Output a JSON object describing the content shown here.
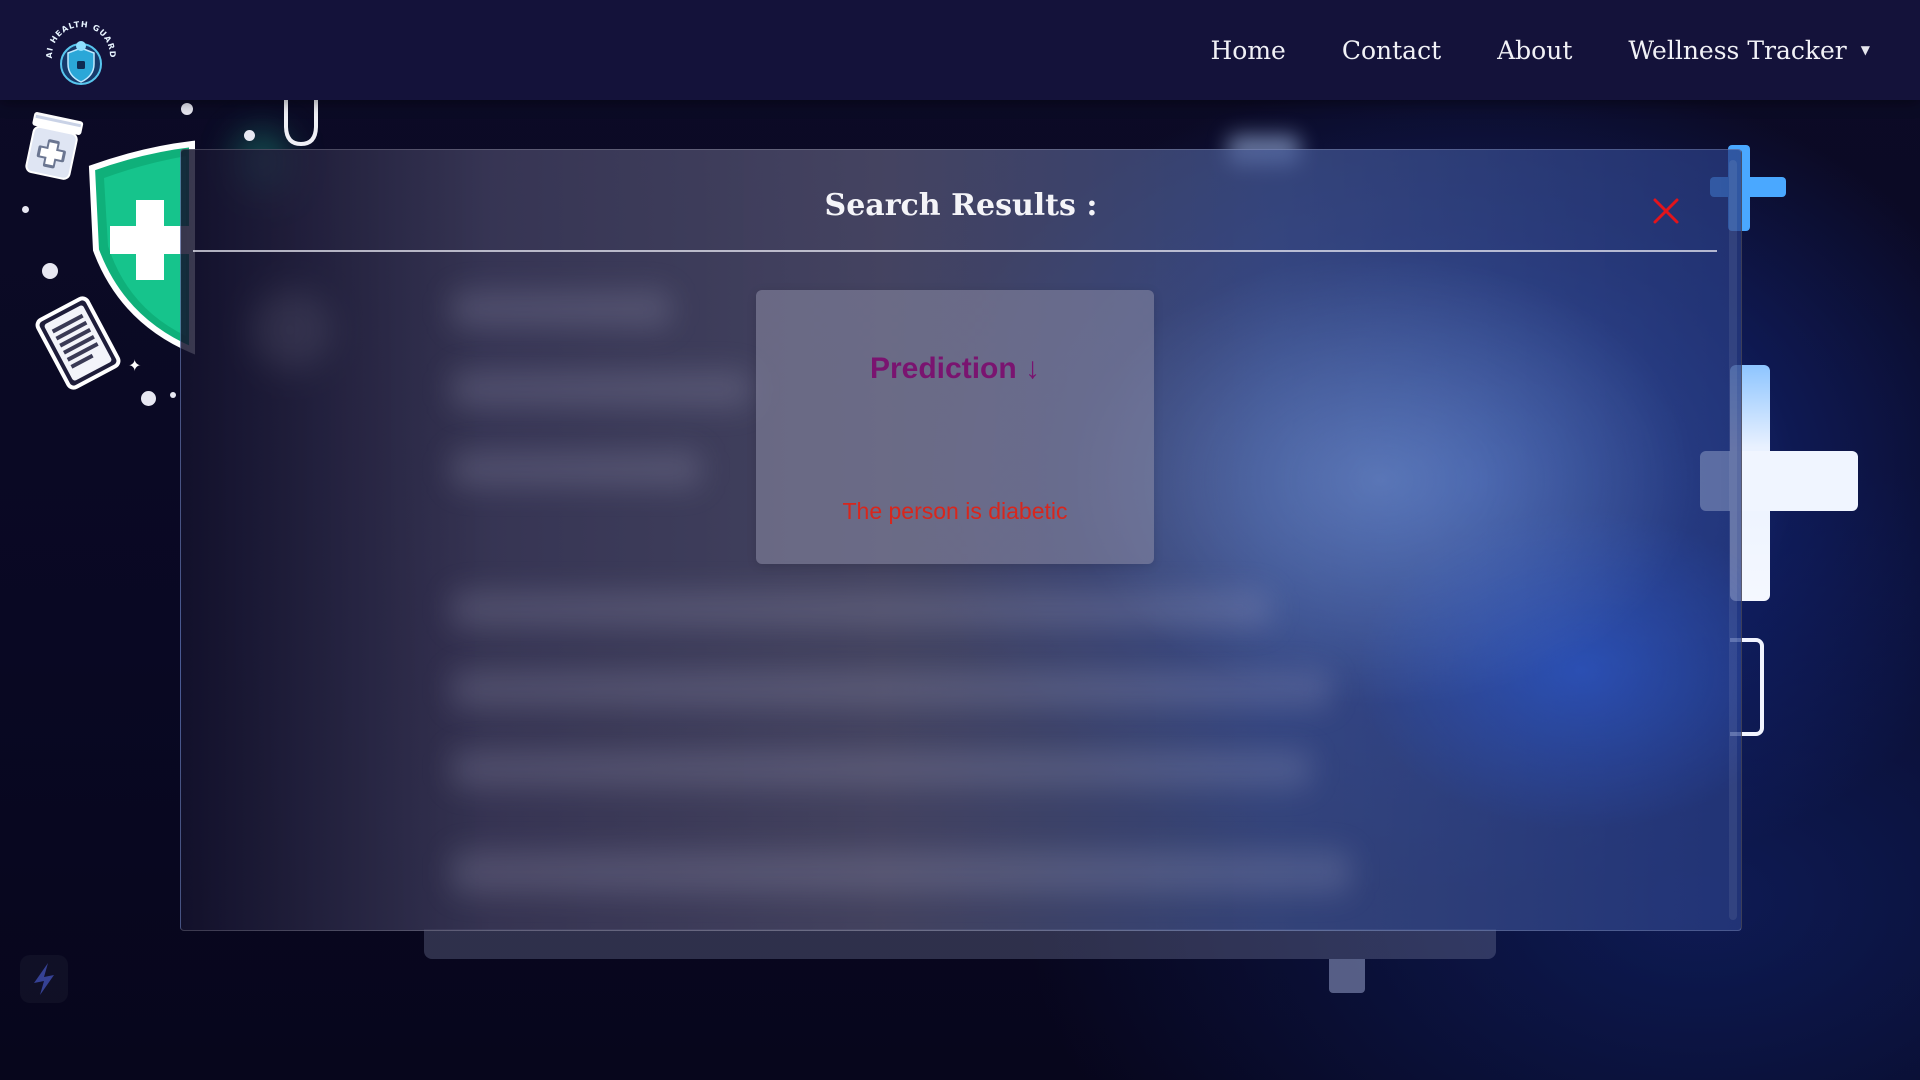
{
  "navbar": {
    "logo_icon": "ai-health-guard-logo",
    "logo_text": "AI HEALTH GUARD",
    "links": [
      {
        "label": "Home"
      },
      {
        "label": "Contact"
      },
      {
        "label": "About"
      },
      {
        "label": "Wellness Tracker",
        "has_dropdown": true
      }
    ]
  },
  "modal": {
    "title": "Search Results :",
    "close_icon": "close-icon",
    "card": {
      "heading": "Prediction ↓",
      "result": "The person is diabetic"
    }
  },
  "colors": {
    "navbar_bg": "#14123a",
    "page_bg": "#0b0a24",
    "prediction_heading": "#7a1470",
    "prediction_result": "#d8261c",
    "close_icon": "#e3141b",
    "shield": "#12b886"
  },
  "decorations": [
    "pill-bottle-icon",
    "shield-plus-icon",
    "document-icon",
    "stethoscope-icon",
    "medical-cross-icon",
    "lightning-icon"
  ]
}
